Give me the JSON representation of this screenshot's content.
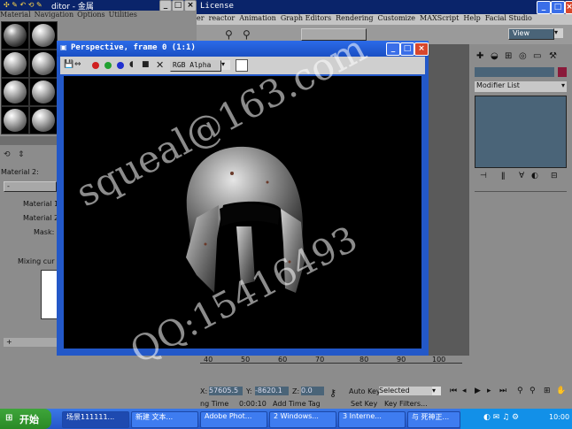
{
  "material_editor": {
    "title": "ditor - 金属",
    "menu": [
      "Material",
      "Navigation",
      "Options",
      "Utilities"
    ],
    "material_label": "Material 2:",
    "mat1_label": "Material 1:",
    "mat2_label": "Material 2:",
    "mask_label": "Mask:",
    "mixing_label": "Mixing cur"
  },
  "max_window": {
    "title": "License",
    "menu": [
      "er",
      "reactor",
      "Animation",
      "Graph Editors",
      "Rendering",
      "Customize",
      "MAXScript",
      "Help",
      "Facial Studio"
    ],
    "view_dropdown": "View",
    "modifier_list": "Modifier List"
  },
  "render_window": {
    "title": "Perspective, frame 0 (1:1)",
    "channel": "RGB Alpha"
  },
  "timeline": {
    "ticks": [
      "40",
      "50",
      "60",
      "70",
      "80",
      "90",
      "100"
    ]
  },
  "status": {
    "x_label": "X:",
    "x_value": "57605.5",
    "y_label": "Y:",
    "y_value": "-8620.1",
    "z_label": "Z:",
    "z_value": "0.0",
    "auto_key": "Auto Key",
    "selected": "Selected",
    "time_label": "ng Time",
    "time_value": "0:00:10",
    "add_time_tag": "Add Time Tag",
    "set_key": "Set Key",
    "key_filters": "Key Filters..."
  },
  "taskbar": {
    "start": "开始",
    "tasks": [
      "场景111111...",
      "新建 文本...",
      "Adobe Phot...",
      "2 Windows...",
      "3 Interne...",
      "与 死神正..."
    ],
    "clock": "10:00"
  },
  "watermark": {
    "line1": "squeal@163.com",
    "line2": "QQ:15416493"
  }
}
